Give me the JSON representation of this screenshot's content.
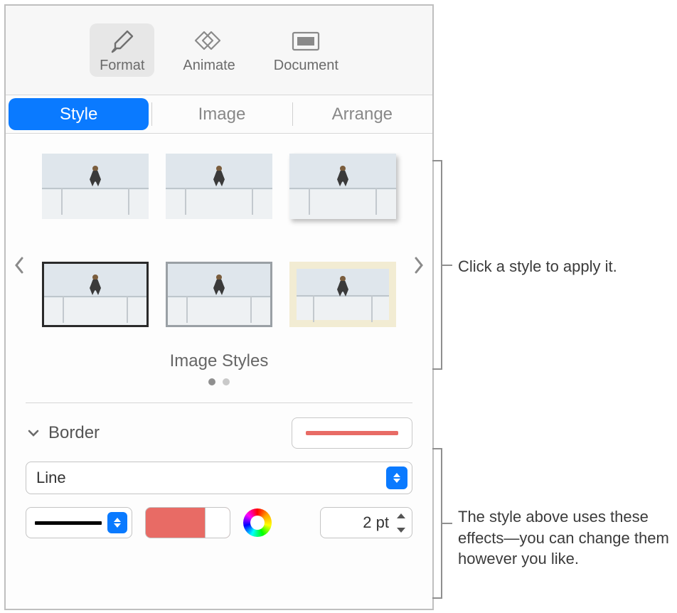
{
  "topTabs": {
    "format": {
      "label": "Format"
    },
    "animate": {
      "label": "Animate"
    },
    "document": {
      "label": "Document"
    }
  },
  "subTabs": {
    "style": {
      "label": "Style"
    },
    "image": {
      "label": "Image"
    },
    "arrange": {
      "label": "Arrange"
    }
  },
  "stylesSection": {
    "title": "Image Styles"
  },
  "borderSection": {
    "title": "Border",
    "typeSelected": "Line",
    "size": "2 pt"
  },
  "annotations": {
    "styles": "Click a style to apply it.",
    "effects": "The style above uses these effects—you can change them however you like."
  }
}
